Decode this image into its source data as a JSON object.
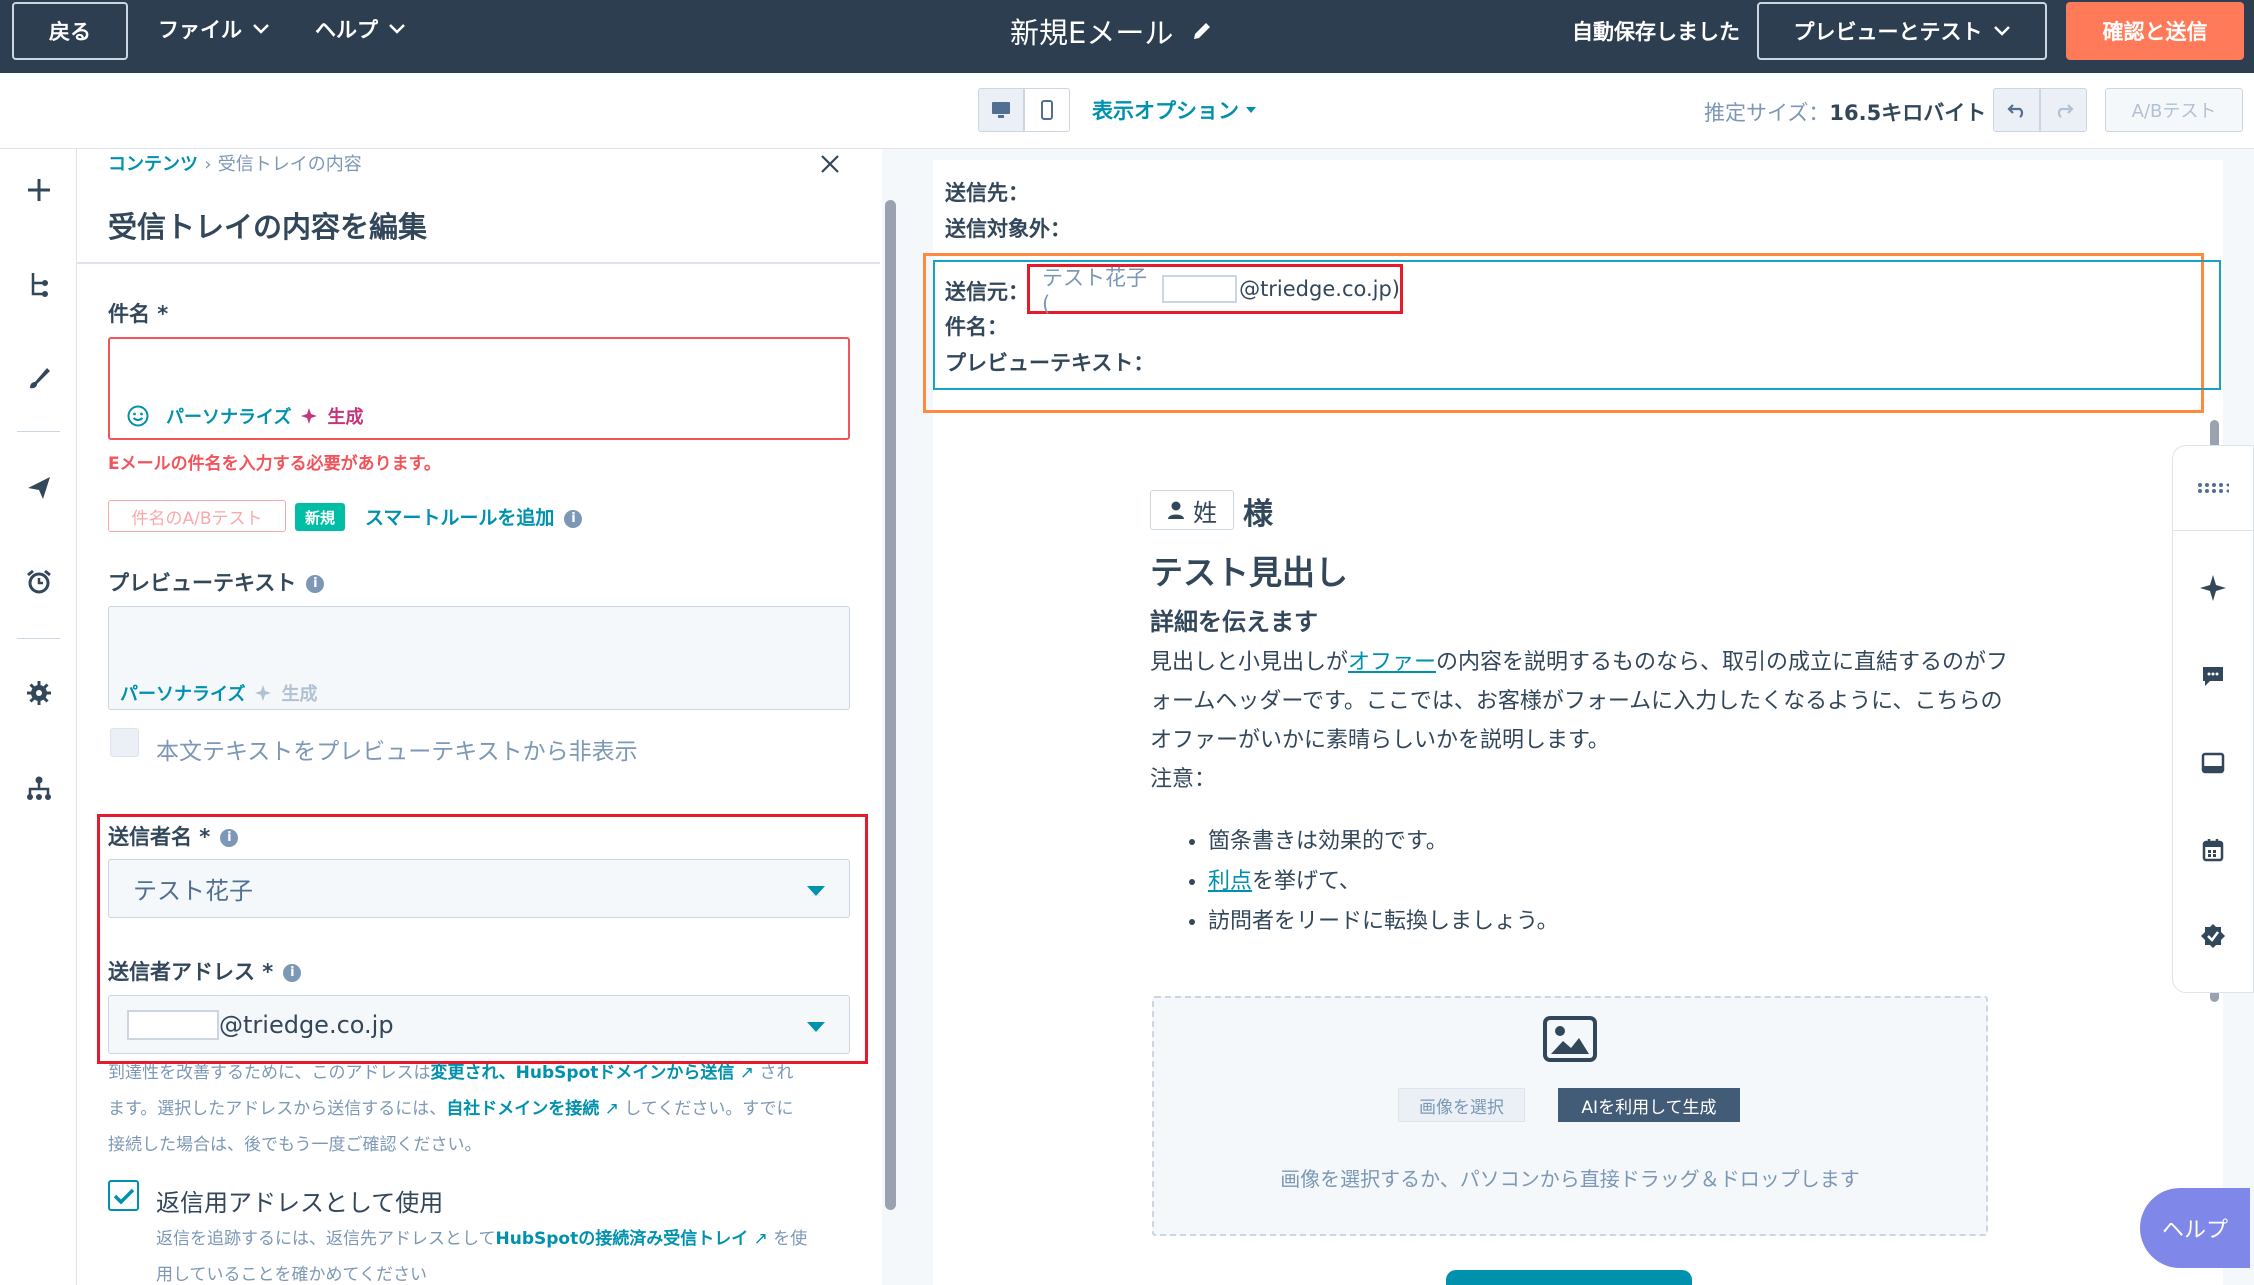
{
  "topbar": {
    "back_label": "戻る",
    "file_menu": "ファイル",
    "help_menu": "ヘルプ",
    "title": "新規Eメール",
    "autosave": "自動保存しました",
    "preview_test": "プレビューとテスト",
    "review_send": "確認と送信"
  },
  "toolbar": {
    "view_options": "表示オプション",
    "est_size_label": "推定サイズ：",
    "est_size_value": "16.5キロバイト",
    "ab_test": "A/Bテスト"
  },
  "panel": {
    "breadcrumb_root": "コンテンツ",
    "breadcrumb_sep": "›",
    "breadcrumb_current": "受信トレイの内容",
    "title": "受信トレイの内容を編集",
    "subject_label": "件名 *",
    "personalize": "パーソナライズ",
    "generate": "生成",
    "subject_error": "Eメールの件名を入力する必要があります。",
    "subject_ab_test": "件名のA/Bテスト",
    "new_badge": "新規",
    "smart_rule": "スマートルールを追加",
    "preview_text_label": "プレビューテキスト",
    "hide_body_text": "本文テキストをプレビューテキストから非表示",
    "sender_name_label": "送信者名 *",
    "sender_name_value": "テスト花子",
    "sender_address_label": "送信者アドレス *",
    "sender_address_domain": "@triedge.co.jp",
    "deliver_help_1a": "到達性を改善するために、このアドレスは",
    "deliver_help_1b": "変更され、HubSpotドメインから送信",
    "deliver_help_1c": " され",
    "deliver_help_2a": "ます。選択したアドレスから送信するには、",
    "deliver_help_2b": "自社ドメインを接続",
    "deliver_help_2c": " してください。すでに",
    "deliver_help_3": "接続した場合は、後でもう一度ご確認ください。",
    "reply_use": "返信用アドレスとして使用",
    "reply_help_a": "返信を追跡するには、返信先アドレスとして",
    "reply_help_b": "HubSpotの接続済み受信トレイ",
    "reply_help_c": " を使",
    "reply_help_d": "用していることを確かめてください"
  },
  "preview": {
    "to_label": "送信先：",
    "exclude_label": "送信対象外：",
    "from_label": "送信元：",
    "from_name": "テスト花子 (",
    "from_domain": "@triedge.co.jp)",
    "subject_label": "件名：",
    "preview_text_label": "プレビューテキスト：",
    "token_label": "姓",
    "honorific": "様",
    "heading": "テスト見出し",
    "subheading": "詳細を伝えます",
    "para_a": "見出しと小見出しが",
    "para_link": "オファー",
    "para_b": "の内容を説明するものなら、取引の成立に直結するのがフォームヘッダーです。ここでは、お客様がフォームに入力したくなるように、こちらのオファーがいかに素晴らしいかを説明します。",
    "note_label": "注意：",
    "bullet_1": "箇条書きは効果的です。",
    "bullet_2_link": "利点",
    "bullet_2_rest": "を挙げて、",
    "bullet_3": "訪問者をリードに転換しましょう。",
    "select_image": "画像を選択",
    "ai_generate": "AIを利用して生成",
    "image_hint": "画像を選択するか、パソコンから直接ドラッグ＆ドロップします"
  },
  "help_button": "ヘルプ",
  "colors": {
    "topbar": "#2d3e50",
    "accent_orange": "#ff7a59",
    "link_teal": "#0091ae",
    "error_red": "#f2545b",
    "annotation_red": "#e61a2a",
    "annotation_orange": "#ff8a3d",
    "help_purple": "#7f87e8"
  }
}
